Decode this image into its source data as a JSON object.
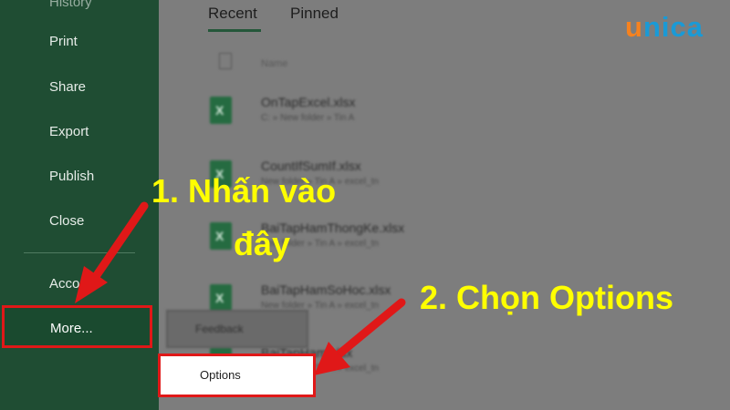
{
  "sidebar": {
    "items": [
      "Print",
      "Share",
      "Export",
      "Publish",
      "Close",
      "Account"
    ],
    "more_label": "More..."
  },
  "main": {
    "tabs": [
      "Recent",
      "Pinned"
    ],
    "column_header": "Name",
    "files": [
      {
        "name": "OnTapExcel.xlsx",
        "path": "C: » New folder » Tin A"
      },
      {
        "name": "CountIfSumIf.xlsx",
        "path": "New folder » Tin A » excel_tn"
      },
      {
        "name": "BaiTapHamThongKe.xlsx",
        "path": "New folder » Tin A » excel_tn"
      },
      {
        "name": "BaiTapHamSoHoc.xlsx",
        "path": "New folder » Tin A » excel_tn"
      },
      {
        "name": "BaiTapHam.xlsx",
        "path": "New folder » Tin A » excel_tn"
      }
    ]
  },
  "popup": {
    "feedback_label": "Feedback",
    "options_label": "Options"
  },
  "annotations": {
    "step1_line1": "1. Nhấn vào",
    "step1_line2": "đây",
    "step2": "2. Chọn Options",
    "color": "#ffff00",
    "arrow_color": "#e01818"
  },
  "logo": {
    "first": "u",
    "rest": "nica"
  }
}
